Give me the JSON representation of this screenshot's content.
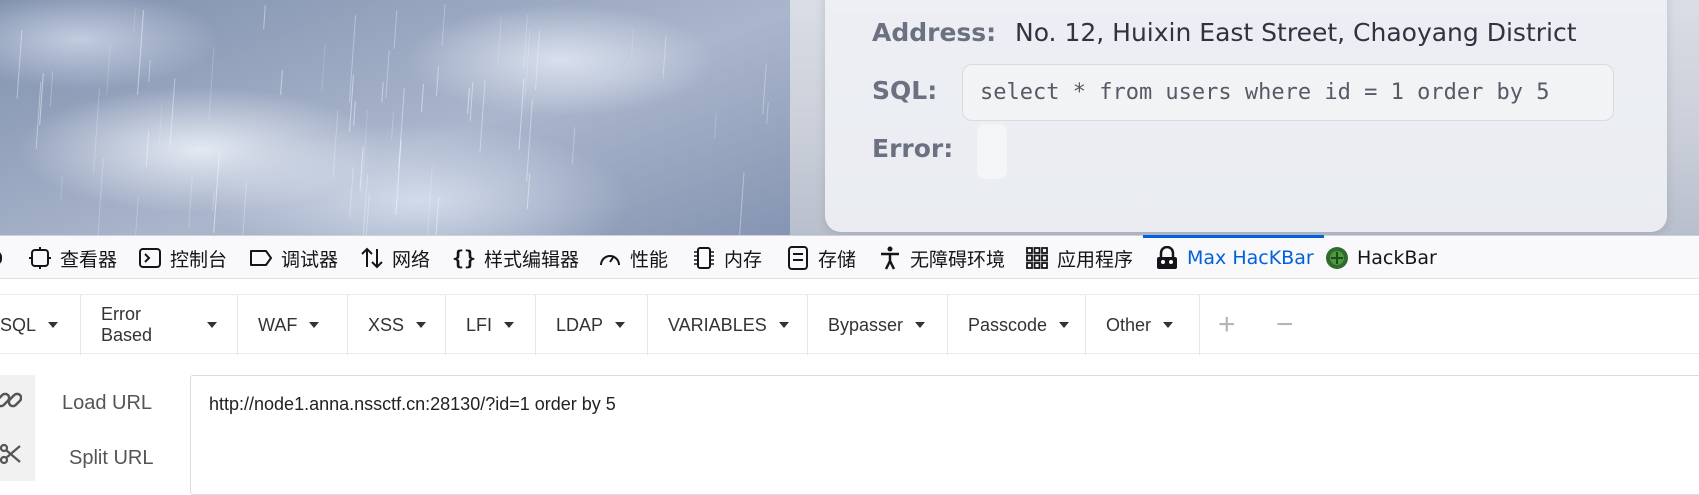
{
  "webpage": {
    "address_label": "Address:",
    "address_value": "No. 12, Huixin East Street, Chaoyang District",
    "sql_label": "SQL:",
    "sql_value": "select * from users where id = 1 order by 5",
    "error_label": "Error:"
  },
  "devtools": {
    "tabs": [
      {
        "label": "查看器",
        "icon": "inspector-icon"
      },
      {
        "label": "控制台",
        "icon": "console-icon"
      },
      {
        "label": "调试器",
        "icon": "debugger-icon"
      },
      {
        "label": "网络",
        "icon": "network-icon"
      },
      {
        "label": "样式编辑器",
        "icon": "style-editor-icon"
      },
      {
        "label": "性能",
        "icon": "performance-icon"
      },
      {
        "label": "内存",
        "icon": "memory-icon"
      },
      {
        "label": "存储",
        "icon": "storage-icon"
      },
      {
        "label": "无障碍环境",
        "icon": "accessibility-icon"
      },
      {
        "label": "应用程序",
        "icon": "application-icon"
      },
      {
        "label": "Max HacKBar",
        "icon": "max-hackbar-icon",
        "active": true
      },
      {
        "label": "HackBar",
        "icon": "hackbar-icon"
      }
    ],
    "active_color": "#0061e0"
  },
  "hackbar": {
    "menus": [
      "SQL",
      "Error Based",
      "WAF",
      "XSS",
      "LFI",
      "LDAP",
      "VARIABLES",
      "Bypasser",
      "Passcode",
      "Other"
    ],
    "add_symbol": "+",
    "remove_symbol": "−",
    "load_url_label": "Load URL",
    "split_url_label": "Split URL",
    "url_value": "http://node1.anna.nssctf.cn:28130/?id=1 order by 5"
  }
}
